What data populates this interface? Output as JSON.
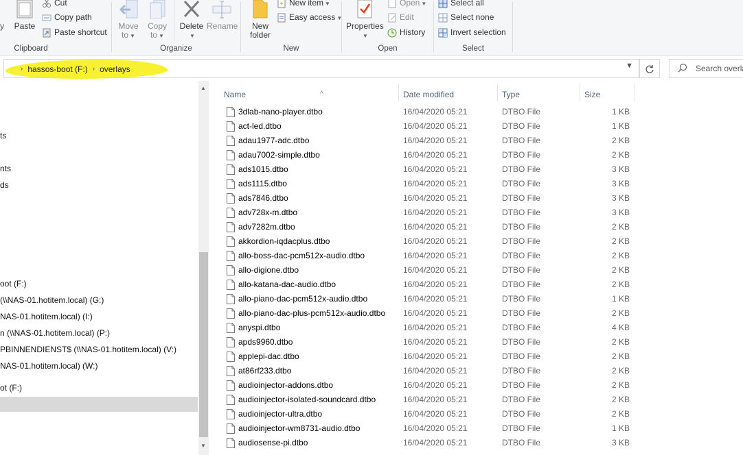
{
  "ribbon": {
    "clipboard": {
      "label": "Clipboard",
      "paste": "Paste",
      "cut": "Cut",
      "copy_path": "Copy path",
      "paste_shortcut": "Paste shortcut",
      "left_partial": "y"
    },
    "organize": {
      "label": "Organize",
      "move_to": [
        "Move",
        "to"
      ],
      "copy_to": [
        "Copy",
        "to"
      ],
      "delete": "Delete",
      "rename": "Rename"
    },
    "new": {
      "label": "New",
      "new_folder": [
        "New",
        "folder"
      ],
      "new_item": "New item",
      "easy_access": "Easy access"
    },
    "open": {
      "label": "Open",
      "properties": "Properties",
      "open": "Open",
      "edit": "Edit",
      "history": "History"
    },
    "select": {
      "label": "Select",
      "select_all": "Select all",
      "select_none": "Select none",
      "invert_selection": "Invert selection"
    }
  },
  "address": {
    "crumbs": [
      "hassos-boot (F:)",
      "overlays"
    ],
    "search_placeholder": "Search overlays"
  },
  "nav": {
    "items": [
      {
        "label": "ts"
      },
      {
        "label": "nts"
      },
      {
        "label": "ds"
      },
      {
        "label": "oot (F:)"
      },
      {
        "label": "(\\\\NAS-01.hotitem.local) (G:)"
      },
      {
        "label": "NAS-01.hotitem.local) (I:)"
      },
      {
        "label": "n (\\\\NAS-01.hotitem.local) (P:)"
      },
      {
        "label": "PBINNENDIENST$ (\\\\NAS-01.hotitem.local) (V:)"
      },
      {
        "label": "NAS-01.hotitem.local) (W:)"
      },
      {
        "label": "ot (F:)"
      },
      {
        "label": ""
      }
    ]
  },
  "columns": {
    "name": "Name",
    "date": "Date modified",
    "type": "Type",
    "size": "Size"
  },
  "files": [
    {
      "name": "3dlab-nano-player.dtbo",
      "date": "16/04/2020 05:21",
      "type": "DTBO File",
      "size": "1 KB"
    },
    {
      "name": "act-led.dtbo",
      "date": "16/04/2020 05:21",
      "type": "DTBO File",
      "size": "1 KB"
    },
    {
      "name": "adau1977-adc.dtbo",
      "date": "16/04/2020 05:21",
      "type": "DTBO File",
      "size": "2 KB"
    },
    {
      "name": "adau7002-simple.dtbo",
      "date": "16/04/2020 05:21",
      "type": "DTBO File",
      "size": "2 KB"
    },
    {
      "name": "ads1015.dtbo",
      "date": "16/04/2020 05:21",
      "type": "DTBO File",
      "size": "3 KB"
    },
    {
      "name": "ads1115.dtbo",
      "date": "16/04/2020 05:21",
      "type": "DTBO File",
      "size": "3 KB"
    },
    {
      "name": "ads7846.dtbo",
      "date": "16/04/2020 05:21",
      "type": "DTBO File",
      "size": "3 KB"
    },
    {
      "name": "adv728x-m.dtbo",
      "date": "16/04/2020 05:21",
      "type": "DTBO File",
      "size": "3 KB"
    },
    {
      "name": "adv7282m.dtbo",
      "date": "16/04/2020 05:21",
      "type": "DTBO File",
      "size": "2 KB"
    },
    {
      "name": "akkordion-iqdacplus.dtbo",
      "date": "16/04/2020 05:21",
      "type": "DTBO File",
      "size": "2 KB"
    },
    {
      "name": "allo-boss-dac-pcm512x-audio.dtbo",
      "date": "16/04/2020 05:21",
      "type": "DTBO File",
      "size": "2 KB"
    },
    {
      "name": "allo-digione.dtbo",
      "date": "16/04/2020 05:21",
      "type": "DTBO File",
      "size": "2 KB"
    },
    {
      "name": "allo-katana-dac-audio.dtbo",
      "date": "16/04/2020 05:21",
      "type": "DTBO File",
      "size": "2 KB"
    },
    {
      "name": "allo-piano-dac-pcm512x-audio.dtbo",
      "date": "16/04/2020 05:21",
      "type": "DTBO File",
      "size": "1 KB"
    },
    {
      "name": "allo-piano-dac-plus-pcm512x-audio.dtbo",
      "date": "16/04/2020 05:21",
      "type": "DTBO File",
      "size": "2 KB"
    },
    {
      "name": "anyspi.dtbo",
      "date": "16/04/2020 05:21",
      "type": "DTBO File",
      "size": "4 KB"
    },
    {
      "name": "apds9960.dtbo",
      "date": "16/04/2020 05:21",
      "type": "DTBO File",
      "size": "2 KB"
    },
    {
      "name": "applepi-dac.dtbo",
      "date": "16/04/2020 05:21",
      "type": "DTBO File",
      "size": "2 KB"
    },
    {
      "name": "at86rf233.dtbo",
      "date": "16/04/2020 05:21",
      "type": "DTBO File",
      "size": "2 KB"
    },
    {
      "name": "audioinjector-addons.dtbo",
      "date": "16/04/2020 05:21",
      "type": "DTBO File",
      "size": "2 KB"
    },
    {
      "name": "audioinjector-isolated-soundcard.dtbo",
      "date": "16/04/2020 05:21",
      "type": "DTBO File",
      "size": "2 KB"
    },
    {
      "name": "audioinjector-ultra.dtbo",
      "date": "16/04/2020 05:21",
      "type": "DTBO File",
      "size": "2 KB"
    },
    {
      "name": "audioinjector-wm8731-audio.dtbo",
      "date": "16/04/2020 05:21",
      "type": "DTBO File",
      "size": "1 KB"
    },
    {
      "name": "audiosense-pi.dtbo",
      "date": "16/04/2020 05:21",
      "type": "DTBO File",
      "size": "3 KB"
    }
  ],
  "colors": {
    "highlight": "#f7f01e",
    "column_header_text": "#4c607a",
    "folder_yellow": "#f4c542",
    "nav_selected": "#d9d9d9"
  },
  "icons": {
    "paste": "paste-icon",
    "cut": "scissors-icon",
    "copy_path": "copy-path-icon",
    "paste_shortcut": "paste-shortcut-icon",
    "move_to": "move-to-icon",
    "copy_to": "copy-to-icon",
    "delete": "delete-x-icon",
    "rename": "rename-icon",
    "new_folder": "new-folder-icon",
    "new_item": "new-item-icon",
    "easy_access": "easy-access-icon",
    "properties": "properties-check-icon",
    "open": "open-icon",
    "edit": "edit-icon",
    "history": "history-icon",
    "select_all": "select-all-icon",
    "select_none": "select-none-icon",
    "invert_selection": "invert-selection-icon",
    "file": "file-icon",
    "search": "search-icon",
    "refresh": "refresh-icon"
  }
}
